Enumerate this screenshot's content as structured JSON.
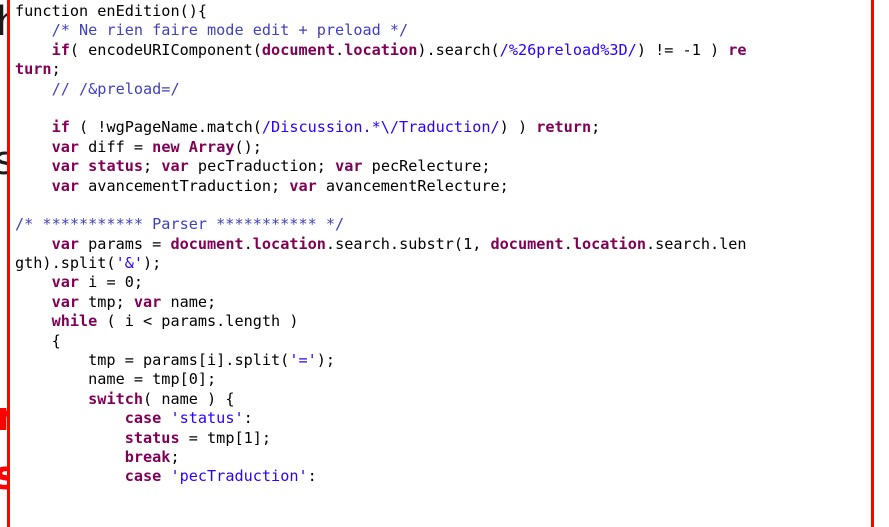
{
  "background": {
    "fragments": [
      {
        "text": "h",
        "color": "#1a1a1a"
      },
      {
        "text": "s",
        "color": "#1a1a1a"
      },
      {
        "text": "n",
        "color": "#ff0000"
      },
      {
        "text": "s",
        "color": "#ff0000"
      }
    ]
  },
  "code": {
    "language": "javascript",
    "lines": [
      [
        {
          "t": "function enEdition(){",
          "c": "fn"
        }
      ],
      [
        {
          "t": "    ",
          "c": ""
        },
        {
          "t": "/* Ne rien faire mode edit + preload */",
          "c": "cm"
        }
      ],
      [
        {
          "t": "    ",
          "c": ""
        },
        {
          "t": "if",
          "c": "kw"
        },
        {
          "t": "( encodeURIComponent(",
          "c": ""
        },
        {
          "t": "document",
          "c": "kw"
        },
        {
          "t": ".",
          "c": ""
        },
        {
          "t": "location",
          "c": "kw"
        },
        {
          "t": ").search(",
          "c": ""
        },
        {
          "t": "/%26preload%3D/",
          "c": "rx"
        },
        {
          "t": ") != -1 ) ",
          "c": ""
        },
        {
          "t": "re",
          "c": "kw"
        }
      ],
      [
        {
          "t": "turn",
          "c": "kw"
        },
        {
          "t": ";",
          "c": ""
        }
      ],
      [
        {
          "t": "    ",
          "c": ""
        },
        {
          "t": "// /&preload=/",
          "c": "cm"
        }
      ],
      [
        {
          "t": "",
          "c": ""
        }
      ],
      [
        {
          "t": "    ",
          "c": ""
        },
        {
          "t": "if",
          "c": "kw"
        },
        {
          "t": " ( !wgPageName.match(",
          "c": ""
        },
        {
          "t": "/Discussion.*\\/Traduction/",
          "c": "rx"
        },
        {
          "t": ") ) ",
          "c": ""
        },
        {
          "t": "return",
          "c": "kw"
        },
        {
          "t": ";",
          "c": ""
        }
      ],
      [
        {
          "t": "    ",
          "c": ""
        },
        {
          "t": "var",
          "c": "kw"
        },
        {
          "t": " diff = ",
          "c": ""
        },
        {
          "t": "new",
          "c": "kw"
        },
        {
          "t": " ",
          "c": ""
        },
        {
          "t": "Array",
          "c": "kw"
        },
        {
          "t": "();",
          "c": ""
        }
      ],
      [
        {
          "t": "    ",
          "c": ""
        },
        {
          "t": "var",
          "c": "kw"
        },
        {
          "t": " ",
          "c": ""
        },
        {
          "t": "status",
          "c": "kw"
        },
        {
          "t": "; ",
          "c": ""
        },
        {
          "t": "var",
          "c": "kw"
        },
        {
          "t": " pecTraduction; ",
          "c": ""
        },
        {
          "t": "var",
          "c": "kw"
        },
        {
          "t": " pecRelecture;",
          "c": ""
        }
      ],
      [
        {
          "t": "    ",
          "c": ""
        },
        {
          "t": "var",
          "c": "kw"
        },
        {
          "t": " avancementTraduction; ",
          "c": ""
        },
        {
          "t": "var",
          "c": "kw"
        },
        {
          "t": " avancementRelecture;",
          "c": ""
        }
      ],
      [
        {
          "t": "",
          "c": ""
        }
      ],
      [
        {
          "t": "/* *********** Parser *********** */",
          "c": "cm"
        }
      ],
      [
        {
          "t": "    ",
          "c": ""
        },
        {
          "t": "var",
          "c": "kw"
        },
        {
          "t": " params = ",
          "c": ""
        },
        {
          "t": "document",
          "c": "kw"
        },
        {
          "t": ".",
          "c": ""
        },
        {
          "t": "location",
          "c": "kw"
        },
        {
          "t": ".search.substr(1, ",
          "c": ""
        },
        {
          "t": "document",
          "c": "kw"
        },
        {
          "t": ".",
          "c": ""
        },
        {
          "t": "location",
          "c": "kw"
        },
        {
          "t": ".search.len",
          "c": ""
        }
      ],
      [
        {
          "t": "gth).split(",
          "c": ""
        },
        {
          "t": "'&'",
          "c": "st"
        },
        {
          "t": ");",
          "c": ""
        }
      ],
      [
        {
          "t": "    ",
          "c": ""
        },
        {
          "t": "var",
          "c": "kw"
        },
        {
          "t": " i = 0;",
          "c": ""
        }
      ],
      [
        {
          "t": "    ",
          "c": ""
        },
        {
          "t": "var",
          "c": "kw"
        },
        {
          "t": " tmp; ",
          "c": ""
        },
        {
          "t": "var",
          "c": "kw"
        },
        {
          "t": " name;",
          "c": ""
        }
      ],
      [
        {
          "t": "    ",
          "c": ""
        },
        {
          "t": "while",
          "c": "kw"
        },
        {
          "t": " ( i < params.length )",
          "c": ""
        }
      ],
      [
        {
          "t": "    {",
          "c": ""
        }
      ],
      [
        {
          "t": "        tmp = params[i].split(",
          "c": ""
        },
        {
          "t": "'='",
          "c": "st"
        },
        {
          "t": ");",
          "c": ""
        }
      ],
      [
        {
          "t": "        name = tmp[0];",
          "c": ""
        }
      ],
      [
        {
          "t": "        ",
          "c": ""
        },
        {
          "t": "switch",
          "c": "kw"
        },
        {
          "t": "( name ) {",
          "c": ""
        }
      ],
      [
        {
          "t": "            ",
          "c": ""
        },
        {
          "t": "case",
          "c": "kw"
        },
        {
          "t": " ",
          "c": ""
        },
        {
          "t": "'status'",
          "c": "st"
        },
        {
          "t": ":",
          "c": ""
        }
      ],
      [
        {
          "t": "            ",
          "c": ""
        },
        {
          "t": "status",
          "c": "kw"
        },
        {
          "t": " = tmp[1];",
          "c": ""
        }
      ],
      [
        {
          "t": "            ",
          "c": ""
        },
        {
          "t": "break",
          "c": "kw"
        },
        {
          "t": ";",
          "c": ""
        }
      ],
      [
        {
          "t": "            ",
          "c": ""
        },
        {
          "t": "case",
          "c": "kw"
        },
        {
          "t": " ",
          "c": ""
        },
        {
          "t": "'pecTraduction'",
          "c": "st"
        },
        {
          "t": ":",
          "c": ""
        }
      ]
    ]
  }
}
